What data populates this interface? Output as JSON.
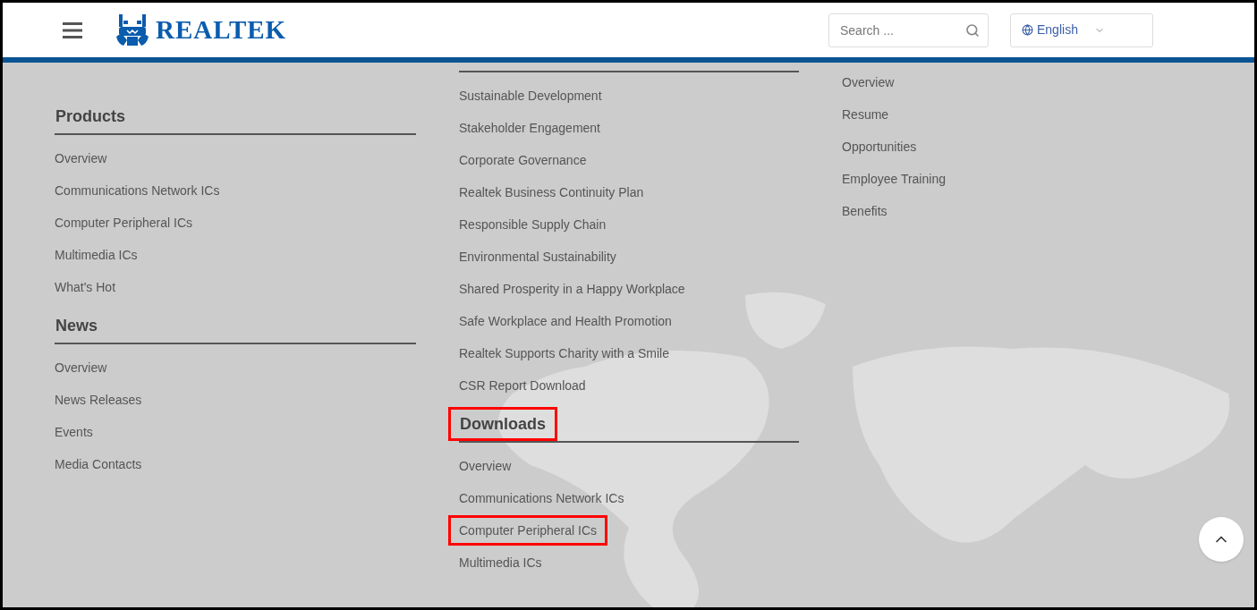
{
  "header": {
    "brand": "REALTEK",
    "search": {
      "placeholder": "Search ..."
    },
    "language": {
      "value": "English"
    }
  },
  "columns": [
    {
      "sections": [
        {
          "heading": "Products",
          "highlighted": false,
          "items": [
            {
              "label": "Overview",
              "highlighted": false
            },
            {
              "label": "Communications Network ICs",
              "highlighted": false
            },
            {
              "label": "Computer Peripheral ICs",
              "highlighted": false
            },
            {
              "label": "Multimedia ICs",
              "highlighted": false
            },
            {
              "label": "What's Hot",
              "highlighted": false
            }
          ]
        },
        {
          "heading": "News",
          "highlighted": false,
          "items": [
            {
              "label": "Overview",
              "highlighted": false
            },
            {
              "label": "News Releases",
              "highlighted": false
            },
            {
              "label": "Events",
              "highlighted": false
            },
            {
              "label": "Media Contacts",
              "highlighted": false
            }
          ]
        }
      ]
    },
    {
      "sections": [
        {
          "items": [
            {
              "label": "Sustainable Development",
              "highlighted": false
            },
            {
              "label": "Stakeholder Engagement",
              "highlighted": false
            },
            {
              "label": "Corporate Governance",
              "highlighted": false
            },
            {
              "label": "Realtek Business Continuity Plan",
              "highlighted": false
            },
            {
              "label": "Responsible Supply Chain",
              "highlighted": false
            },
            {
              "label": "Environmental Sustainability",
              "highlighted": false
            },
            {
              "label": "Shared Prosperity in a Happy Workplace",
              "highlighted": false
            },
            {
              "label": "Safe Workplace and Health Promotion",
              "highlighted": false
            },
            {
              "label": "Realtek Supports Charity with a Smile",
              "highlighted": false
            },
            {
              "label": "CSR Report Download",
              "highlighted": false
            }
          ]
        },
        {
          "heading": "Downloads",
          "highlighted": true,
          "items": [
            {
              "label": "Overview",
              "highlighted": false
            },
            {
              "label": "Communications Network ICs",
              "highlighted": false
            },
            {
              "label": "Computer Peripheral ICs",
              "highlighted": true
            },
            {
              "label": "Multimedia ICs",
              "highlighted": false
            }
          ]
        }
      ]
    },
    {
      "sections": [
        {
          "items": [
            {
              "label": "Overview",
              "highlighted": false
            },
            {
              "label": "Resume",
              "highlighted": false
            },
            {
              "label": "Opportunities",
              "highlighted": false
            },
            {
              "label": "Employee Training",
              "highlighted": false
            },
            {
              "label": "Benefits",
              "highlighted": false
            }
          ]
        }
      ]
    }
  ]
}
